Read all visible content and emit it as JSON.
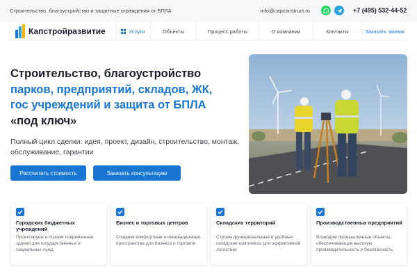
{
  "topbar": {
    "tagline": "Строительство, благоустройство и защитные ограждения от БПЛА",
    "email": "info@capconstruct.ru",
    "whatsapp_icon": "whatsapp-icon",
    "telegram_icon": "telegram-icon",
    "phone": "+7 (495) 532-44-52"
  },
  "nav": {
    "logo": "Капстройразвитие",
    "items": [
      {
        "label": "Услуги",
        "active": true
      },
      {
        "label": "Объекты"
      },
      {
        "label": "Процесс работы"
      },
      {
        "label": "О компании"
      },
      {
        "label": "Контакты"
      }
    ],
    "cta": "Заказать звонок"
  },
  "hero": {
    "title_line1": "Строительство, благоустройство",
    "title_line2": "парков, предприятий, складов, ЖК,",
    "title_line3": "гос учреждений и защита от БПЛА",
    "title_line4": "«под ключ»",
    "subtitle": "Полный цикл сделки: идея, проект, дизайн, строительство, монтаж, обслуживание, гарантии",
    "btn_calc": "Рассчитать стоимость",
    "btn_consult": "Заказать консультацию"
  },
  "cards": [
    {
      "title": "Городских бюджетных учреждений",
      "desc": "Проектируем и строим современные здания для государственных и социальных нужд."
    },
    {
      "title": "Бизнес и торговых центров",
      "desc": "Создаем комфортные и инновационные пространства для бизнеса и торговли"
    },
    {
      "title": "Складских территорий",
      "desc": "Строим функциональные и удобные складские комплексы для эффективной логистики"
    },
    {
      "title": "Производственных предприятий",
      "desc": "Возводим промышленные объекты, обеспечивающие высокую производительность и безопасность"
    }
  ],
  "colors": {
    "accent": "#1976d2",
    "whatsapp": "#25d366",
    "telegram": "#2aa3dd"
  }
}
